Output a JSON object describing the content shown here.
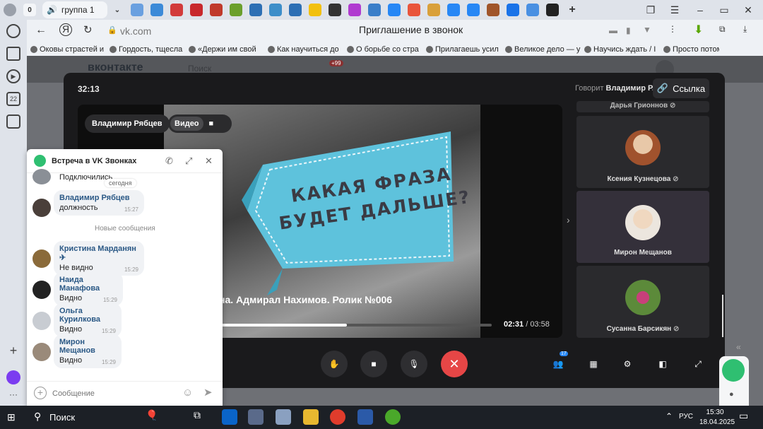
{
  "browser": {
    "tab_count": "0",
    "active_tab_label": "группа 1",
    "url": "vk.com",
    "page_title": "Приглашение в звонок",
    "bookmarks": [
      "Оковы страстей и",
      "Гордость, тщесла",
      "«Держи им свой",
      "Как научиться до",
      "О борьбе со стра",
      "Прилагаешь усил",
      "Великое дело — у",
      "Научись ждать / I",
      "Просто потому"
    ]
  },
  "vk": {
    "logo": "вконтакте",
    "search_placeholder": "Поиск",
    "notifications": "+99"
  },
  "call": {
    "timer": "32:13",
    "speaker_prefix": "Говорит",
    "speaker_name": "Владимир Р.",
    "link_label": "Ссылка",
    "presenter": "Владимир Рябцев",
    "video_tab_label": "Видео",
    "sign_line1": "КАКАЯ ФРАЗА",
    "sign_line2": "БУДЕТ ДАЛЬШЕ?",
    "video_caption": "на. Адмирал Нахимов. Ролик №006",
    "time_current": "02:31",
    "time_sep": " / ",
    "time_total": "03:58",
    "progress": 0.47,
    "participants": [
      {
        "name": "Дарья Грионнов",
        "muted": true
      },
      {
        "name": "Ксения Кузнецова",
        "muted": true
      },
      {
        "name": "Мирон Мещанов",
        "muted": false
      },
      {
        "name": "Сусанна Барсикян",
        "muted": true
      }
    ],
    "participant_badge": "17"
  },
  "chat": {
    "title": "Встреча в VK Звонках",
    "connected_text": "Подключились",
    "date_divider": "сегодня",
    "new_messages": "Новые сообщения",
    "input_placeholder": "Сообщение",
    "messages": [
      {
        "name": "Владимир Рябцев",
        "text": "должность",
        "time": "15:27"
      },
      {
        "name": "Кристина Марданян",
        "text": "Не видно",
        "time": "15:29"
      },
      {
        "name": "Наида Манафова",
        "text": "Видно",
        "time": "15:29"
      },
      {
        "name": "Ольга Курилкова",
        "text": "Видно",
        "time": "15:29"
      },
      {
        "name": "Мирон Мещанов",
        "text": "Видно",
        "time": "15:29"
      }
    ]
  },
  "taskbar": {
    "search_label": "Поиск",
    "language": "РУС",
    "time": "15:30",
    "date": "18.04.2025"
  },
  "colors": {
    "end_call": "#e64646",
    "accent_blue": "#2a5885",
    "vk_green": "#2fbf71"
  }
}
